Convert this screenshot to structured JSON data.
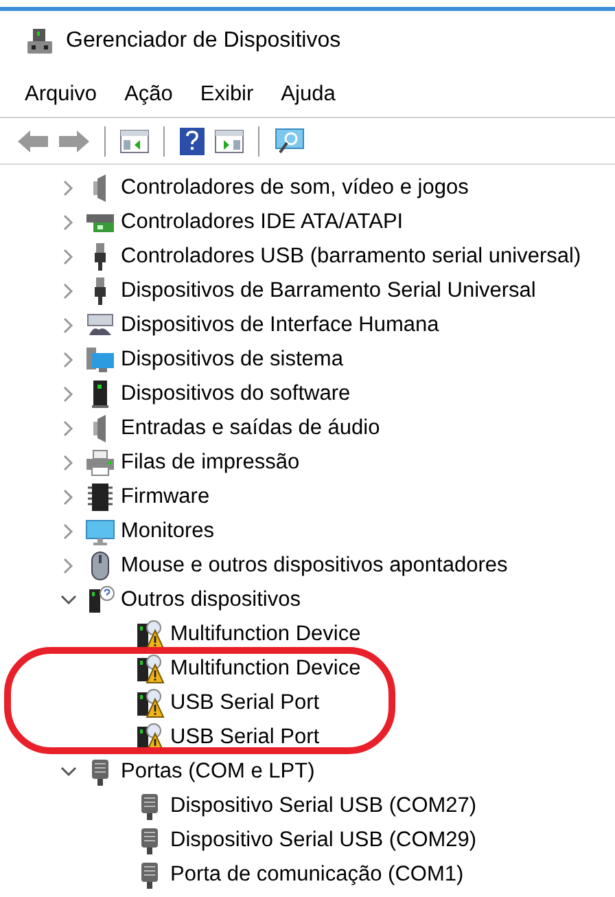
{
  "window": {
    "title": "Gerenciador de Dispositivos"
  },
  "menu": [
    "Arquivo",
    "Ação",
    "Exibir",
    "Ajuda"
  ],
  "tree": [
    {
      "label": "Controladores de som, vídeo e jogos",
      "kind": "speaker",
      "expanded": false
    },
    {
      "label": "Controladores IDE ATA/ATAPI",
      "kind": "drive",
      "expanded": false
    },
    {
      "label": "Controladores USB (barramento serial universal)",
      "kind": "usb",
      "expanded": false
    },
    {
      "label": "Dispositivos de Barramento Serial Universal",
      "kind": "usb",
      "expanded": false
    },
    {
      "label": "Dispositivos de Interface Humana",
      "kind": "keyboard",
      "expanded": false
    },
    {
      "label": "Dispositivos de sistema",
      "kind": "system",
      "expanded": false
    },
    {
      "label": "Dispositivos do software",
      "kind": "tower",
      "expanded": false
    },
    {
      "label": "Entradas e saídas de áudio",
      "kind": "speaker",
      "expanded": false
    },
    {
      "label": "Filas de impressão",
      "kind": "printer",
      "expanded": false
    },
    {
      "label": "Firmware",
      "kind": "chip",
      "expanded": false
    },
    {
      "label": "Monitores",
      "kind": "monitor",
      "expanded": false
    },
    {
      "label": "Mouse e outros dispositivos apontadores",
      "kind": "mouse",
      "expanded": false
    },
    {
      "label": "Outros dispositivos",
      "kind": "unknown",
      "expanded": true,
      "children": [
        {
          "label": "Multifunction Device",
          "kind": "warning",
          "circled": false
        },
        {
          "label": "Multifunction Device",
          "kind": "warning",
          "circled": true
        },
        {
          "label": "USB Serial Port",
          "kind": "warning",
          "circled": true
        },
        {
          "label": "USB Serial Port",
          "kind": "warning",
          "circled": true
        }
      ]
    },
    {
      "label": "Portas (COM e LPT)",
      "kind": "port",
      "expanded": true,
      "children": [
        {
          "label": "Dispositivo Serial USB (COM27)",
          "kind": "port",
          "circled": false
        },
        {
          "label": "Dispositivo Serial USB (COM29)",
          "kind": "port",
          "circled": false
        },
        {
          "label": "Porta de comunicação (COM1)",
          "kind": "port",
          "circled": false
        }
      ]
    }
  ]
}
